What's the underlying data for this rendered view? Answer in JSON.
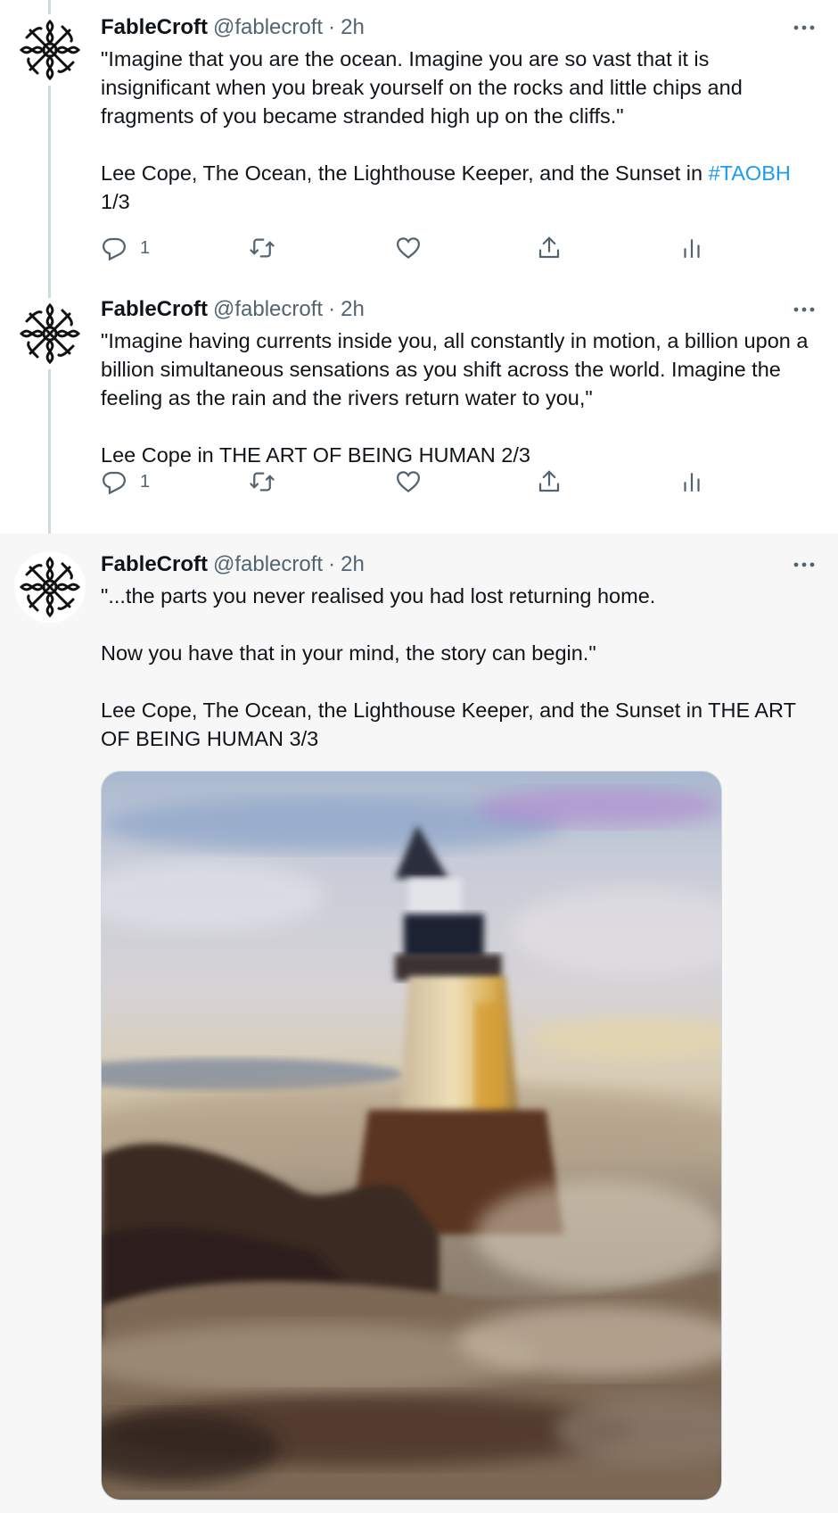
{
  "author": {
    "name": "FableCroft",
    "handle": "@fablecroft",
    "separator": "·"
  },
  "tweets": [
    {
      "time": "2h",
      "paragraphs": [
        "\"Imagine that you are the ocean. Imagine you are so vast that it is insignificant when you break yourself on the rocks and little chips and fragments of you became stranded high up on the cliffs.\""
      ],
      "attribution_prefix": "Lee Cope, The Ocean, the Lighthouse Keeper, and the Sunset in ",
      "hashtag": "#TAOBH",
      "attribution_suffix": "1/3",
      "reply_count": "1"
    },
    {
      "time": "2h",
      "paragraphs": [
        "\"Imagine having currents inside you, all constantly in motion, a billion upon a billion simultaneous sensations as you shift across the world. Imagine the feeling as the rain and the rivers return water to you,\"",
        "Lee Cope in THE ART OF BEING HUMAN 2/3"
      ],
      "reply_count": "1"
    },
    {
      "time": "2h",
      "paragraphs": [
        "\"...the parts you never realised you had lost returning home.",
        "Now you have that in your mind, the story can begin.\"",
        "Lee Cope, The Ocean, the Lighthouse Keeper, and the Sunset in THE ART OF BEING HUMAN 3/3"
      ]
    }
  ],
  "icons": {
    "avatar": "celtic-knot-logo",
    "more": "more-horizontal-icon",
    "reply": "reply-icon",
    "retweet": "retweet-icon",
    "like": "heart-icon",
    "share": "share-icon",
    "stats": "analytics-icon"
  },
  "colors": {
    "text": "#0f1419",
    "secondary": "#536471",
    "link": "#1d9bf0",
    "thread_line": "#cfd9de",
    "highlight_bg": "#f7f7f7"
  }
}
